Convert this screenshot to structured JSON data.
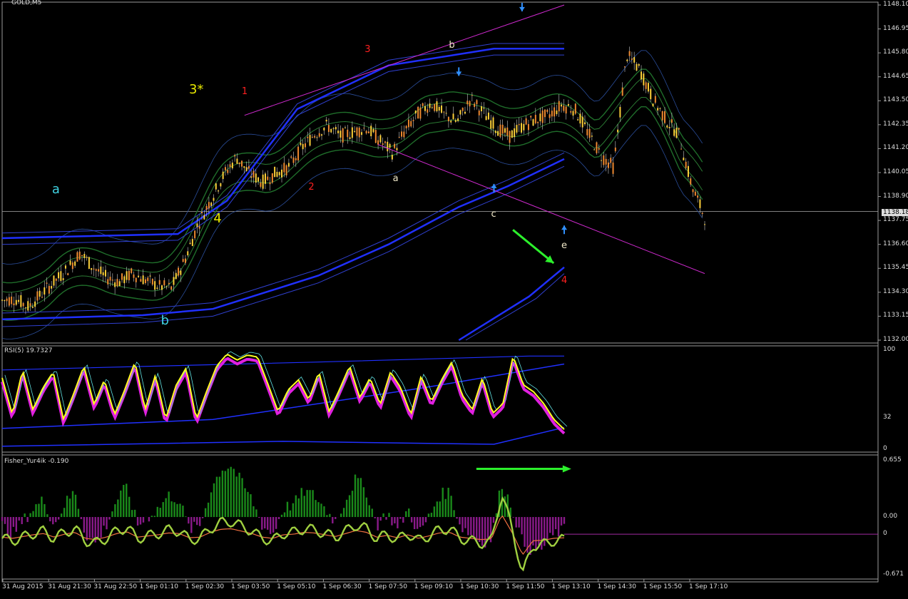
{
  "chart_data": [
    {
      "type": "candlestick",
      "title": "GOLD,M5",
      "y_ticks": [
        "1148.10",
        "1146.95",
        "1145.80",
        "1144.65",
        "1143.50",
        "1142.35",
        "1141.20",
        "1140.05",
        "1138.90",
        "1137.75",
        "1136.60",
        "1135.45",
        "1134.30",
        "1133.15",
        "1132.00"
      ],
      "ylim": [
        1132.0,
        1148.1
      ],
      "current_price": "1138.18",
      "x_ticks": [
        "31 Aug 2015",
        "31 Aug 21:30",
        "31 Aug 22:50",
        "1 Sep 01:10",
        "1 Sep 02:30",
        "1 Sep 03:50",
        "1 Sep 05:10",
        "1 Sep 06:30",
        "1 Sep 07:50",
        "1 Sep 09:10",
        "1 Sep 10:30",
        "1 Sep 11:50",
        "1 Sep 13:10",
        "1 Sep 14:30",
        "1 Sep 15:50",
        "1 Sep 17:10"
      ],
      "close_path": [
        1133.9,
        1134.0,
        1133.6,
        1134.2,
        1134.8,
        1135.4,
        1136.2,
        1135.5,
        1135.0,
        1134.8,
        1135.2,
        1134.9,
        1134.6,
        1134.5,
        1135.8,
        1137.5,
        1138.7,
        1139.9,
        1140.8,
        1140.0,
        1139.6,
        1140.0,
        1140.3,
        1141.2,
        1141.9,
        1142.3,
        1141.8,
        1142.0,
        1142.2,
        1141.6,
        1141.0,
        1142.1,
        1142.9,
        1143.4,
        1142.8,
        1142.5,
        1143.6,
        1142.9,
        1142.2,
        1141.8,
        1142.3,
        1142.6,
        1142.8,
        1143.3,
        1143.1,
        1142.0,
        1140.9,
        1140.3,
        1145.7,
        1145.0,
        1143.6,
        1142.6,
        1141.9,
        1139.4,
        1137.9
      ],
      "annotations": [
        {
          "text": "a",
          "color": "#3fd0e0",
          "x": 0.075,
          "y": 1139.3
        },
        {
          "text": "b",
          "color": "#3fd0e0",
          "x": 0.23,
          "y": 1133.0
        },
        {
          "text": "3*",
          "color": "#e8e800",
          "x": 0.27,
          "y": 1144.1
        },
        {
          "text": "4",
          "color": "#e8e800",
          "x": 0.305,
          "y": 1137.9
        },
        {
          "text": "1",
          "color": "#ff2020",
          "x": 0.345,
          "y": 1143.9
        },
        {
          "text": "3",
          "color": "#ff2020",
          "x": 0.52,
          "y": 1145.9
        },
        {
          "text": "2",
          "color": "#ff2020",
          "x": 0.44,
          "y": 1139.3
        },
        {
          "text": "b",
          "color": "#f0e8c8",
          "x": 0.64,
          "y": 1146.1
        },
        {
          "text": "a",
          "color": "#f0e8c8",
          "x": 0.56,
          "y": 1139.7
        },
        {
          "text": "c",
          "color": "#f0e8c8",
          "x": 0.7,
          "y": 1138.0
        },
        {
          "text": "e",
          "color": "#f0e8c8",
          "x": 0.8,
          "y": 1136.5
        },
        {
          "text": "4",
          "color": "#ff2020",
          "x": 0.8,
          "y": 1134.8
        }
      ]
    },
    {
      "type": "line",
      "title": "RSI(5) 19.7327",
      "y_ticks": [
        "100",
        "32",
        "0"
      ],
      "ylim": [
        0,
        100
      ],
      "values": [
        72,
        35,
        80,
        40,
        62,
        78,
        30,
        56,
        84,
        45,
        70,
        35,
        60,
        88,
        40,
        75,
        30,
        64,
        82,
        30,
        58,
        84,
        96,
        90,
        95,
        93,
        66,
        38,
        60,
        70,
        50,
        78,
        38,
        60,
        84,
        52,
        72,
        45,
        78,
        62,
        35,
        74,
        48,
        70,
        88,
        55,
        40,
        72,
        36,
        46,
        94,
        65,
        58,
        46,
        30,
        20
      ]
    },
    {
      "type": "bar",
      "title": "Fisher_Yur4ik -0.190",
      "y_ticks": [
        "0.655",
        "0.00",
        "-0.671"
      ],
      "ylim": [
        -0.671,
        0.655
      ],
      "current_value_label": "0",
      "values": [
        -0.1,
        -0.2,
        -0.05,
        0.1,
        0.2,
        -0.1,
        0.15,
        0.3,
        -0.2,
        -0.3,
        -0.1,
        0.2,
        0.35,
        -0.1,
        0.0,
        0.1,
        0.25,
        0.2,
        -0.15,
        -0.1,
        0.3,
        0.55,
        0.6,
        0.4,
        0.2,
        -0.1,
        -0.2,
        0.1,
        0.15,
        0.3,
        0.25,
        0.1,
        -0.05,
        0.2,
        0.45,
        0.3,
        -0.1,
        0.05,
        -0.15,
        0.1,
        -0.2,
        0.0,
        0.25,
        0.3,
        -0.1,
        -0.2,
        -0.3,
        -0.25,
        0.4,
        0.1,
        -0.3,
        -0.4,
        -0.35,
        -0.2,
        -0.15
      ]
    }
  ]
}
